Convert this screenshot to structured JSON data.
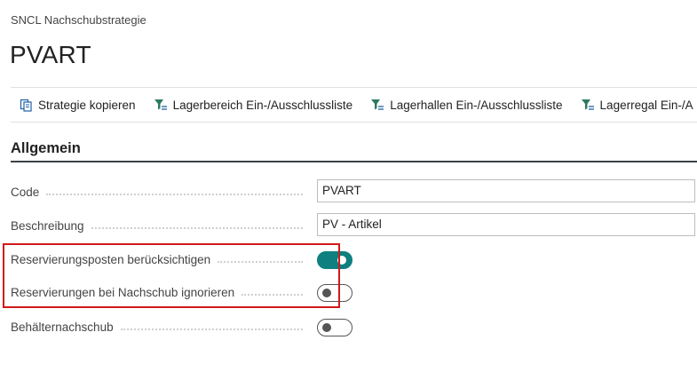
{
  "breadcrumb": "SNCL Nachschubstrategie",
  "page_title": "PVART",
  "actions": [
    {
      "label": "Strategie kopieren",
      "icon": "copy-document-icon"
    },
    {
      "label": "Lagerbereich Ein-/Ausschlussliste",
      "icon": "filter-list-icon"
    },
    {
      "label": "Lagerhallen Ein-/Ausschlussliste",
      "icon": "filter-list-icon"
    },
    {
      "label": "Lagerregal Ein-/A",
      "icon": "filter-list-icon"
    }
  ],
  "section": {
    "title": "Allgemein"
  },
  "fields": {
    "code": {
      "label": "Code",
      "value": "PVART"
    },
    "beschreibung": {
      "label": "Beschreibung",
      "value": "PV - Artikel"
    },
    "reservierungsposten": {
      "label": "Reservierungsposten berücksichtigen",
      "checked": true
    },
    "nachschub_ignorieren": {
      "label": "Reservierungen bei Nachschub ignorieren",
      "checked": false
    },
    "behaelternachschub": {
      "label": "Behälternachschub",
      "checked": false
    }
  },
  "colors": {
    "accent": "#0f7f7f",
    "highlight": "#d11a1a"
  }
}
